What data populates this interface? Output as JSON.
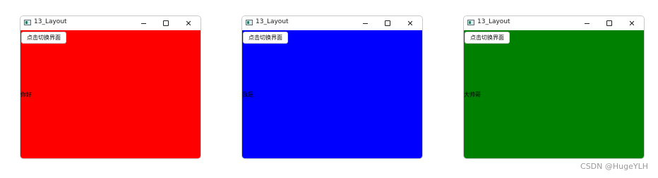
{
  "windows": [
    {
      "title": "13_Layout",
      "button_label": "点击切换界面",
      "content_text": "你好",
      "background": "#ff0000"
    },
    {
      "title": "13_Layout",
      "button_label": "点击切换界面",
      "content_text": "我是",
      "background": "#0000ff"
    },
    {
      "title": "13_Layout",
      "button_label": "点击切换界面",
      "content_text": "大帅哥",
      "background": "#008000"
    }
  ],
  "caption_buttons": {
    "minimize": "minimize-icon",
    "maximize": "maximize-icon",
    "close": "close-icon"
  },
  "app_icon": "app-window-icon",
  "watermark": "CSDN @HugeYLH"
}
